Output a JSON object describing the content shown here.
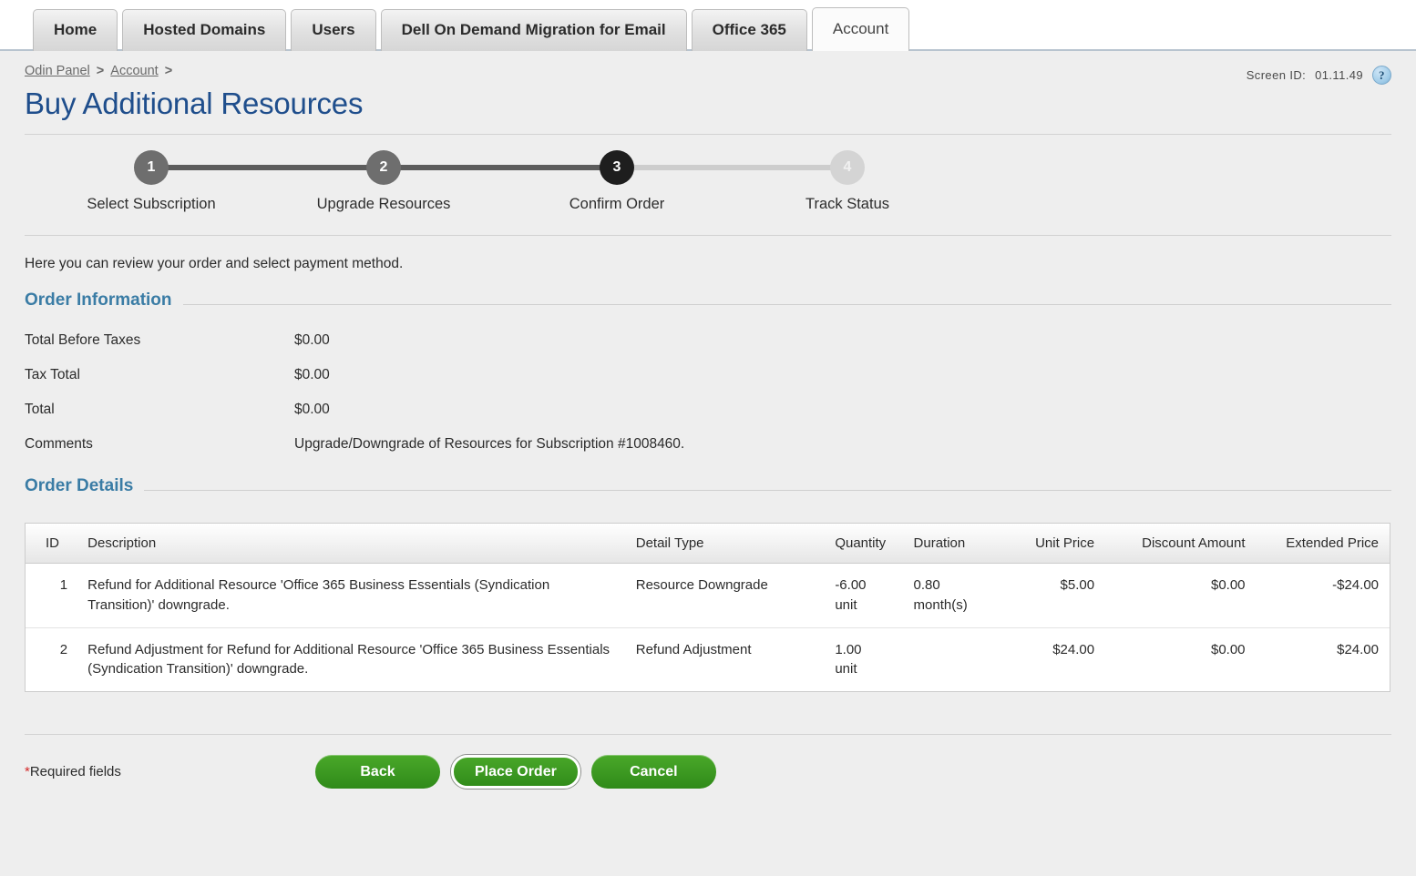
{
  "tabs": [
    {
      "label": "Home",
      "active": false
    },
    {
      "label": "Hosted Domains",
      "active": false
    },
    {
      "label": "Users",
      "active": false
    },
    {
      "label": "Dell On Demand Migration for Email",
      "active": false
    },
    {
      "label": "Office 365",
      "active": false
    },
    {
      "label": "Account",
      "active": true
    }
  ],
  "breadcrumb": {
    "items": [
      "Odin Panel",
      "Account"
    ],
    "separator": ">",
    "trailing": ">"
  },
  "header": {
    "screen_id_label": "Screen ID:",
    "screen_id_value": "01.11.49",
    "help_icon": "question-mark-icon",
    "title": "Buy Additional Resources"
  },
  "stepper": {
    "steps": [
      {
        "number": "1",
        "label": "Select Subscription",
        "state": "done"
      },
      {
        "number": "2",
        "label": "Upgrade Resources",
        "state": "done"
      },
      {
        "number": "3",
        "label": "Confirm Order",
        "state": "active"
      },
      {
        "number": "4",
        "label": "Track Status",
        "state": "todo"
      }
    ]
  },
  "intro": "Here you can review your order and select payment method.",
  "order_information": {
    "heading": "Order Information",
    "rows": [
      {
        "key": "Total Before Taxes",
        "value": "$0.00"
      },
      {
        "key": "Tax Total",
        "value": "$0.00"
      },
      {
        "key": "Total",
        "value": "$0.00"
      },
      {
        "key": "Comments",
        "value": "Upgrade/Downgrade of Resources for Subscription #1008460."
      }
    ]
  },
  "order_details": {
    "heading": "Order Details",
    "columns": [
      "ID",
      "Description",
      "Detail Type",
      "Quantity",
      "Duration",
      "Unit Price",
      "Discount Amount",
      "Extended Price"
    ],
    "rows": [
      {
        "id": "1",
        "description": "Refund for Additional Resource 'Office 365 Business Essentials (Syndication Transition)' downgrade.",
        "detail_type": "Resource Downgrade",
        "quantity_value": "-6.00",
        "quantity_unit": "unit",
        "duration_value": "0.80",
        "duration_unit": "month(s)",
        "unit_price": "$5.00",
        "discount_amount": "$0.00",
        "extended_price": "-$24.00",
        "extended_price_negative": true
      },
      {
        "id": "2",
        "description": "Refund Adjustment for Refund for Additional Resource 'Office 365 Business Essentials (Syndication Transition)' downgrade.",
        "detail_type": "Refund Adjustment",
        "quantity_value": "1.00",
        "quantity_unit": "unit",
        "duration_value": "",
        "duration_unit": "",
        "unit_price": "$24.00",
        "discount_amount": "$0.00",
        "extended_price": "$24.00",
        "extended_price_negative": false
      }
    ]
  },
  "footer": {
    "required_star": "*",
    "required_text": "Required fields",
    "buttons": [
      {
        "label": "Back",
        "focused": false
      },
      {
        "label": "Place Order",
        "focused": true
      },
      {
        "label": "Cancel",
        "focused": false
      }
    ]
  },
  "colors": {
    "page_background": "#eeeeee",
    "title_blue": "#1f4e8c",
    "section_heading_blue": "#3a7ca5",
    "button_green": "#3d9a22",
    "negative_red": "#f51f2e",
    "step_done_gray": "#6e6e6e",
    "step_active_black": "#1e1e1e",
    "step_todo_gray": "#d4d4d4"
  }
}
